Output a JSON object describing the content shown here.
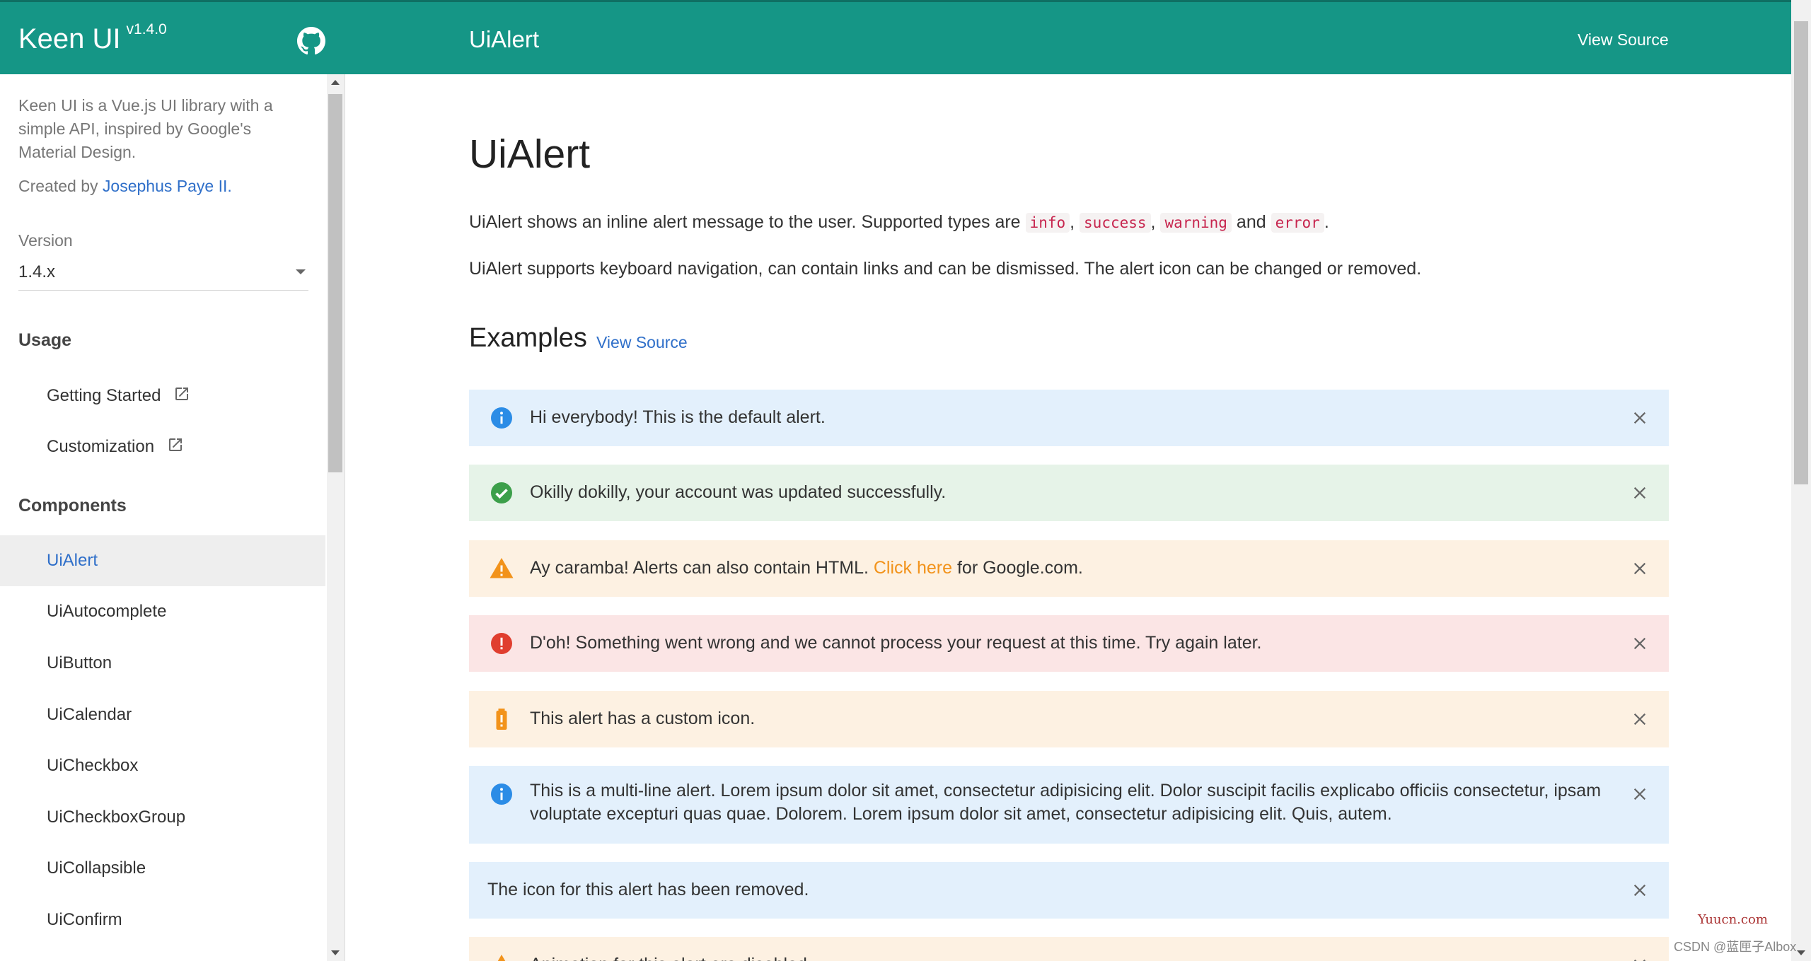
{
  "header": {
    "brand_name": "Keen UI",
    "brand_version": "v1.4.0",
    "github_icon": "github-icon",
    "title": "UiAlert",
    "view_source": "View Source",
    "bg_color": "#159686"
  },
  "sidebar": {
    "description": "Keen UI is a Vue.js UI library with a simple API, inspired by Google's Material Design.",
    "credit_prefix": "Created by ",
    "credit_author": "Josephus Paye II.",
    "version_label": "Version",
    "version_value": "1.4.x",
    "usage_heading": "Usage",
    "usage_items": [
      "Getting Started",
      "Customization"
    ],
    "components_heading": "Components",
    "component_items": [
      "UiAlert",
      "UiAutocomplete",
      "UiButton",
      "UiCalendar",
      "UiCheckbox",
      "UiCheckboxGroup",
      "UiCollapsible",
      "UiConfirm"
    ],
    "active_item": "UiAlert"
  },
  "main": {
    "title": "UiAlert",
    "intro_prefix": "UiAlert shows an inline alert message to the user. Supported types are ",
    "types": [
      "info",
      "success",
      "warning",
      "error"
    ],
    "intro_and": "and",
    "intro_period": ".",
    "intro2": "UiAlert supports keyboard navigation, can contain links and can be dismissed. The alert icon can be changed or removed.",
    "examples_heading": "Examples",
    "examples_link": "View Source"
  },
  "alerts": [
    {
      "type": "info",
      "icon": "info-icon",
      "text": "Hi everybody! This is the default alert."
    },
    {
      "type": "success",
      "icon": "check-circle-icon",
      "text": "Okilly dokilly, your account was updated successfully."
    },
    {
      "type": "warning",
      "icon": "warning-icon",
      "text_before": "Ay caramba! Alerts can also contain HTML. ",
      "link": "Click here",
      "text_after": " for Google.com."
    },
    {
      "type": "error",
      "icon": "error-icon",
      "text": "D'oh! Something went wrong and we cannot process your request at this time. Try again later."
    },
    {
      "type": "warning",
      "icon": "battery-alert-icon",
      "text": "This alert has a custom icon."
    },
    {
      "type": "info",
      "icon": "info-icon",
      "text": "This is a multi-line alert. Lorem ipsum dolor sit amet, consectetur adipisicing elit. Dolor suscipit facilis explicabo officiis consectetur, ipsam voluptate excepturi quas quae. Dolorem. Lorem ipsum dolor sit amet, consectetur adipisicing elit. Quis, autem."
    },
    {
      "type": "info",
      "icon": "none",
      "text": "The icon for this alert has been removed."
    },
    {
      "type": "warning",
      "icon": "warning-icon",
      "text": "Animation for this alert are disabled."
    }
  ],
  "watermark": {
    "site": "Yuucn.com",
    "credit": "CSDN @蓝匣子Albox"
  }
}
